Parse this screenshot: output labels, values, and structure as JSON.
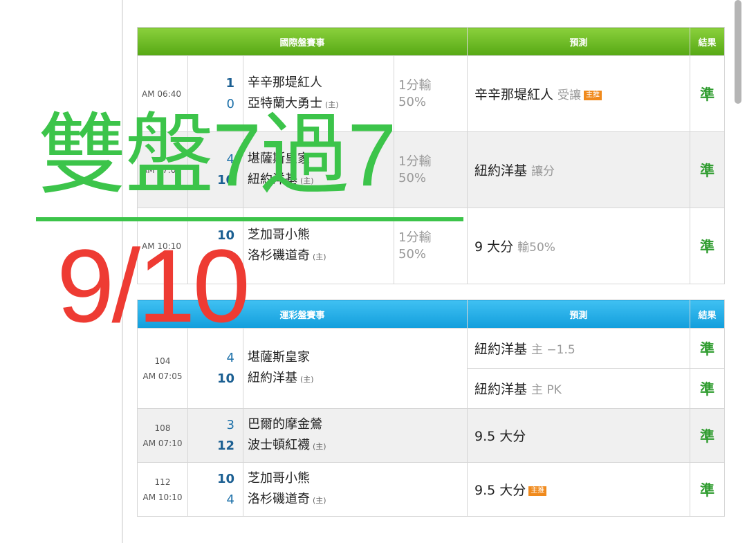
{
  "international": {
    "header": {
      "match": "國際盤賽事",
      "prediction": "預測",
      "result": "結果"
    },
    "rows": [
      {
        "time": "AM 06:40",
        "score1": "1",
        "score2": "0",
        "team1": "辛辛那堤紅人",
        "team2": "亞特蘭大勇士",
        "host_mark": "(主)",
        "odds_line1": "1分輸",
        "odds_line2": "50%",
        "pick": "辛辛那堤紅人",
        "pick_note": "受讓",
        "badge": "主推",
        "result": "準"
      },
      {
        "time": "AM 07:05",
        "score1": "4",
        "score2": "10",
        "team1": "堪薩斯皇家",
        "team2": "紐約洋基",
        "host_mark": "(主)",
        "odds_line1": "1分輸",
        "odds_line2": "50%",
        "pick": "紐約洋基",
        "pick_note": "讓分",
        "badge": "",
        "result": "準"
      },
      {
        "time": "AM 10:10",
        "score1": "10",
        "score2": "4",
        "team1": "芝加哥小熊",
        "team2": "洛杉磯道奇",
        "host_mark": "(主)",
        "odds_line1": "1分輸",
        "odds_line2": "50%",
        "pick": "9 大分",
        "pick_note": "輸50%",
        "badge": "",
        "result": "準"
      }
    ]
  },
  "lottery": {
    "header": {
      "match": "運彩盤賽事",
      "prediction": "預測",
      "result": "結果"
    },
    "rows": [
      {
        "num": "104",
        "time": "AM 07:05",
        "score1": "4",
        "score2": "10",
        "team1": "堪薩斯皇家",
        "team2": "紐約洋基",
        "host_mark": "(主)",
        "predictions": [
          {
            "pick": "紐約洋基",
            "note": "主 −1.5",
            "result": "準"
          },
          {
            "pick": "紐約洋基",
            "note": "主 PK",
            "result": "準"
          }
        ]
      },
      {
        "num": "108",
        "time": "AM 07:10",
        "score1": "3",
        "score2": "12",
        "team1": "巴爾的摩金鶯",
        "team2": "波士頓紅襪",
        "host_mark": "(主)",
        "pick": "9.5 大分",
        "badge": "",
        "result": "準"
      },
      {
        "num": "112",
        "time": "AM 10:10",
        "score1": "10",
        "score2": "4",
        "team1": "芝加哥小熊",
        "team2": "洛杉磯道奇",
        "host_mark": "(主)",
        "pick": "9.5 大分",
        "badge": "主推",
        "result": "準"
      }
    ]
  },
  "overlay": {
    "headline": "雙盤7過7",
    "date": "9/10"
  },
  "colors": {
    "intl_header": "#56a814",
    "lottery_header": "#129edc",
    "result": "#2f9c2f",
    "headline": "#3cc44a",
    "date": "#ee3b33",
    "badge": "#f08a1c"
  }
}
